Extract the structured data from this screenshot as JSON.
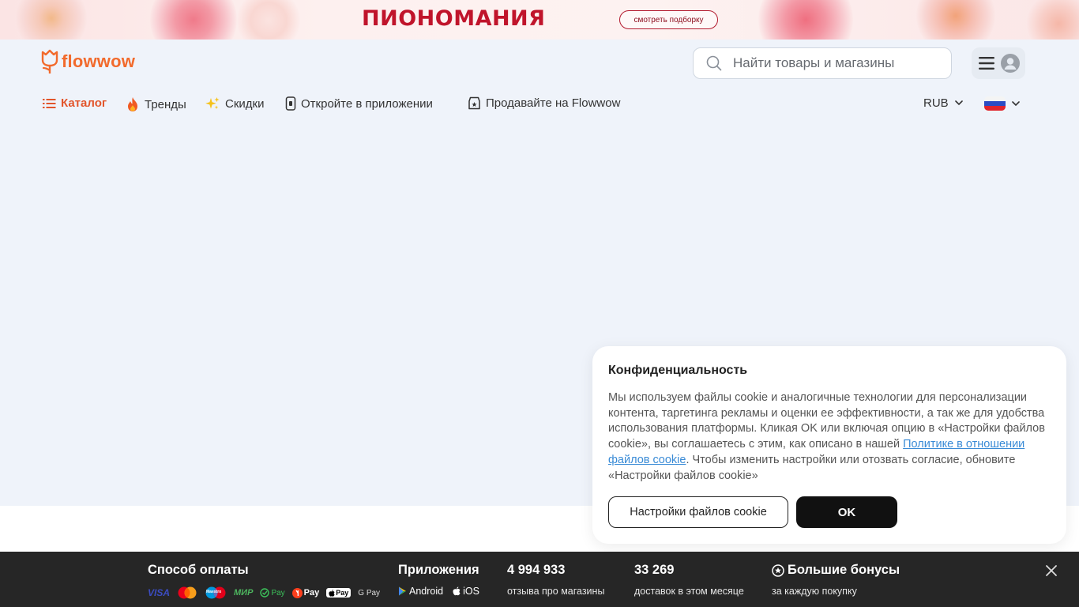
{
  "promo": {
    "title": "ПИОНОМАНИЯ",
    "button_label": "смотреть подборку"
  },
  "header": {
    "logo_text": "flowwow",
    "search_placeholder": "Найти товары и магазины"
  },
  "nav": {
    "catalog": "Каталог",
    "trends": "Тренды",
    "discounts": "Скидки",
    "open_app": "Откройте в приложении",
    "sell": "Продавайте на Flowwow",
    "currency": "RUB"
  },
  "cookie": {
    "title": "Конфиденциальность",
    "text_before_link": "Мы используем файлы cookie и аналогичные технологии для персонализации контента, таргетинга рекламы и оценки ее эффективности, а так же для удобства использования платформы. Кликая OK или включая опцию в «Настройки файлов cookie», вы соглашаетесь с этим, как описано в нашей ",
    "link_text": "Политике в отношении файлов cookie",
    "text_after_link": ". Чтобы изменить настройки или отозвать согласие, обновите «Настройки файлов cookie»",
    "settings_button": "Настройки файлов cookie",
    "ok_button": "OK"
  },
  "footer": {
    "payment_title": "Способ оплаты",
    "payment_methods": {
      "visa": "VISA",
      "maestro": "Maestro",
      "mir": "МИР",
      "spay": "Pay",
      "ypay": "Pay",
      "apple": "Pay",
      "gpay": "G Pay"
    },
    "apps_title": "Приложения",
    "android": "Android",
    "ios": "iOS",
    "reviews_count": "4 994 933",
    "reviews_label": "отзыва про магазины",
    "deliveries_count": "33 269",
    "deliveries_label": "доставок в этом месяце",
    "bonus_title": "Большие бонусы",
    "bonus_label": "за каждую покупку"
  },
  "colors": {
    "brand_orange": "#f26a2c",
    "promo_red": "#c0142b",
    "header_bg": "#eff3fa",
    "footer_bg": "#262626"
  }
}
